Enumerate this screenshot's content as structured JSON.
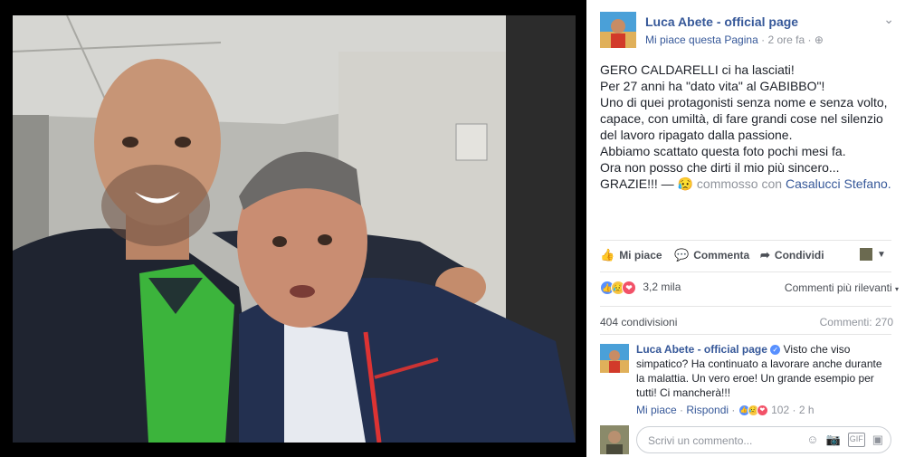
{
  "post": {
    "page_name": "Luca Abete - official page",
    "like_page": "Mi piace questa Pagina",
    "separator": "·",
    "time": "2 ore fa",
    "privacy_icon": "globe-icon",
    "menu_icon": "chevron-down-icon",
    "lines": [
      "GERO CALDARELLI ci ha lasciati!",
      "Per 27 anni ha \"dato vita\" al GABIBBO\"!",
      "Uno di quei protagonisti senza nome e senza volto, capace, con umiltà, di fare grandi cose nel silenzio del lavoro ripagato dalla passione.",
      "Abbiamo scattato questa foto pochi mesi fa.",
      "Ora non posso che dirti il mio più sincero..."
    ],
    "last_line_prefix": "GRAZIE!!! —",
    "feeling_emoji": "😥",
    "feeling": "commosso con",
    "tagged": "Casalucci Stefano."
  },
  "actions": {
    "like": "Mi piace",
    "comment": "Commenta",
    "share": "Condividi"
  },
  "reactions": {
    "count": "3,2 mila",
    "sort": "Commenti più rilevanti"
  },
  "stats": {
    "shares": "404 condivisioni",
    "comments": "Commenti: 270"
  },
  "comment": {
    "author": "Luca Abete - official page",
    "text": "Visto che viso simpatico? Ha continuato a lavorare anche durante la malattia. Un vero eroe! Un grande esempio per tutti! Ci mancherà!!!",
    "like": "Mi piace",
    "reply": "Rispondi",
    "reactions": "102",
    "time": "2 h"
  },
  "composer": {
    "placeholder": "Scrivi un commento..."
  },
  "colors": {
    "link": "#365899",
    "muted": "#90949c",
    "like_blue": "#5890ff",
    "love_red": "#f25268",
    "sad_yellow": "#f7c84b"
  }
}
